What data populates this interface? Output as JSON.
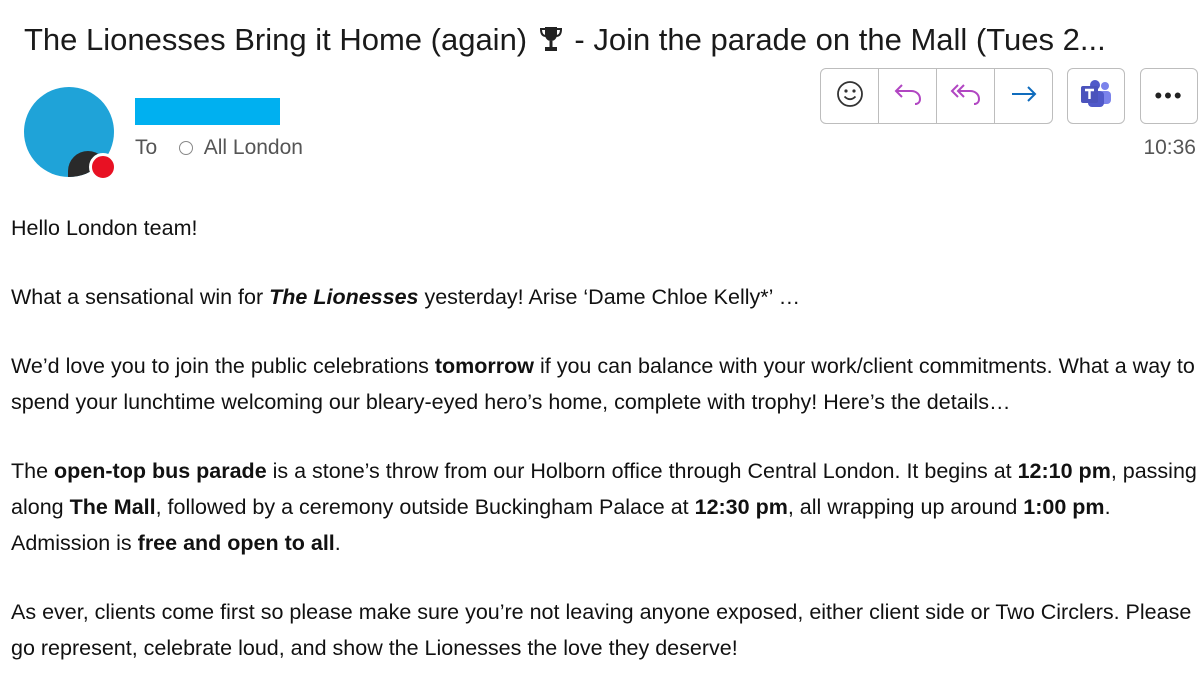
{
  "email": {
    "subject_part1": "The Lionesses Bring it Home (again)",
    "subject_part2": " - Join the parade on the Mall (Tues 2...",
    "to_label": "To",
    "recipient": "All London",
    "time": "10:36"
  },
  "toolbar": {
    "emoji": "emoji-icon",
    "reply": "reply-icon",
    "reply_all": "reply-all-icon",
    "forward": "forward-icon",
    "teams": "teams-icon",
    "more_label": "•••",
    "accent": "#b146c2",
    "forward_color": "#0f6cbd",
    "teams_color": "#4b53bc"
  },
  "body": {
    "greeting": "Hello London team!",
    "p1_a": "What a sensational win for ",
    "p1_b": "The Lionesses",
    "p1_c": " yesterday! Arise ‘Dame Chloe Kelly*’ …",
    "p2_a": "We’d love you to join the public celebrations ",
    "p2_b": "tomorrow",
    "p2_c": " if you can balance with your work/client commitments. What a way to spend your lunchtime welcoming our bleary-eyed hero’s home, complete with trophy! Here’s the details…",
    "p3_a": "The ",
    "p3_b": "open-top bus parade",
    "p3_c": " is a stone’s throw from our Holborn office through Central London. It begins at ",
    "p3_d": "12:10 pm",
    "p3_e": ", passing along ",
    "p3_f": "The Mall",
    "p3_g": ", followed by a ceremony outside Buckingham Palace at ",
    "p3_h": "12:30 pm",
    "p3_i": ", all wrapping up around ",
    "p3_j": "1:00 pm",
    "p3_k": ". Admission is ",
    "p3_l": "free and open to all",
    "p3_m": ".",
    "p4": "As ever, clients come first so please make sure you’re not leaving anyone exposed, either client side or Two Circlers. Please go represent, celebrate loud, and show the Lionesses the love they deserve!"
  }
}
